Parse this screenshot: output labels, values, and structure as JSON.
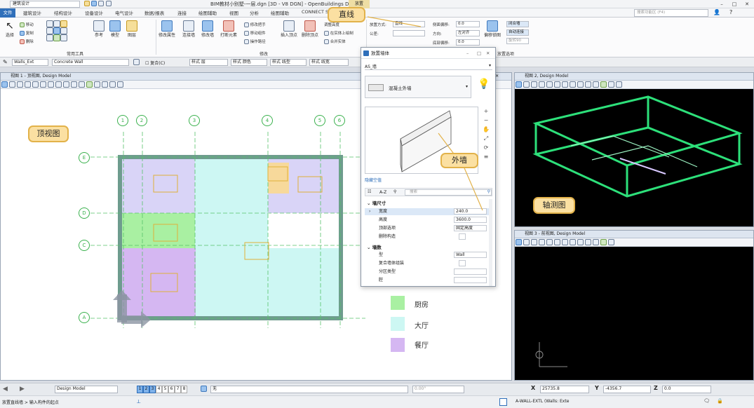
{
  "titlebar": {
    "workspace": "建筑设计",
    "title": "BIM教材小别墅-一层.dgn [3D - V8 DGN] - OpenBuildings Designer",
    "context_tab": "放置"
  },
  "menu": {
    "file": "文件",
    "tabs": [
      "建筑设计",
      "结构设计",
      "设备设计",
      "电气设计",
      "数据/报表",
      "连接",
      "绘图辅助",
      "视图",
      "分析",
      "绘图辅助",
      "CONNECT S"
    ],
    "search_placeholder": "搜索功能区 (F4)"
  },
  "ribbon": {
    "select": "选择",
    "move": "移动",
    "copy": "复制",
    "delete": "删除",
    "common_tools": "常用工具",
    "reference": "参考",
    "model": "模型",
    "layer": "图层",
    "modify_props": "修改属性",
    "join_wall": "连接墙",
    "modify_wall": "修改墙",
    "break_element": "打断元素",
    "modify_handle": "修改把手",
    "move_component": "移动组件",
    "operate_path": "操作路径",
    "insert_vertex": "插入顶点",
    "delete_vertex": "删除顶点",
    "adjust_height": "调整高度",
    "on_solid": "在实体上绘制",
    "merge_solid": "合并实体",
    "modify_group": "修改",
    "place_mode_label": "放置方式:",
    "place_mode_value": "直线",
    "formula_label": "公差:",
    "side_offset": "侧面偏移:",
    "side_offset_val": "0.0",
    "direction": "方向:",
    "direction_val": "左对齐",
    "bottom_offset": "底部偏移:",
    "bottom_offset_val": "0.0",
    "offset_snap": "偏移锁图",
    "close_wall": "闭合墙",
    "auto_connect": "自动连接",
    "rotate": "旋转90",
    "place_options": "放置选项"
  },
  "attrbar": {
    "style": "Walls_Ext",
    "material": "Concrete Wall",
    "complex": "复合(C)",
    "layer_label": "样式 层",
    "color_label": "样式 颜色",
    "linestyle_label": "样式 线型",
    "lineweight_label": "样式 线宽"
  },
  "view1": {
    "title": "视图 1 - 顶视图, Design Model",
    "grid_cols": [
      "1",
      "2",
      "3",
      "4",
      "5",
      "6"
    ],
    "grid_rows": [
      "E",
      "D",
      "C",
      "A"
    ]
  },
  "view2": {
    "title": "视图 2, Design Model"
  },
  "view3": {
    "title": "视图 3 - 前视图, Design Model"
  },
  "callouts": {
    "line": "直线",
    "top_view": "顶视图",
    "outer_wall": "外墙",
    "iso_view": "轴测图"
  },
  "legend": [
    {
      "label": "厨房",
      "color": "#a9f0a2"
    },
    {
      "label": "大厅",
      "color": "#cdf7f3"
    },
    {
      "label": "餐厅",
      "color": "#d5b7f2"
    }
  ],
  "dialog": {
    "title": "放置墙体",
    "catalog": "AS_墙",
    "type": "混凝土外墙",
    "hide_empty": "隐藏空值",
    "search_placeholder": "搜索",
    "group_dimensions": "墙尺寸",
    "group_wall": "墙数",
    "rows": [
      {
        "k": "宽度",
        "v": "240.0",
        "selected": true
      },
      {
        "k": "高度",
        "v": "3600.0"
      },
      {
        "k": "顶部选项",
        "v": "固定高度"
      },
      {
        "k": "删除构造",
        "v": ""
      }
    ],
    "rows2": [
      {
        "k": "型",
        "v": "Wall"
      },
      {
        "k": "复合墙体组装",
        "v": ""
      },
      {
        "k": "分区类型",
        "v": ""
      },
      {
        "k": "腔",
        "v": ""
      }
    ]
  },
  "status": {
    "model": "Design Model",
    "views": [
      "1",
      "2",
      "3",
      "4",
      "5",
      "6",
      "7",
      "8"
    ],
    "level": "无",
    "angle": "0.00°",
    "x_label": "X",
    "x_val": "25735.8",
    "y_label": "Y",
    "y_val": "-4356.7",
    "z_label": "Z",
    "z_val": "0.0",
    "prompt": "放置直线墙 > 输入构件的起点",
    "wall_info": "A-WALL-EXTL (Walls: Exte"
  },
  "colors": {
    "accent": "#2f6fba",
    "callout_bg": "#fbe0a2",
    "grid_green": "#56c26a",
    "iso_green": "#2de07a"
  }
}
